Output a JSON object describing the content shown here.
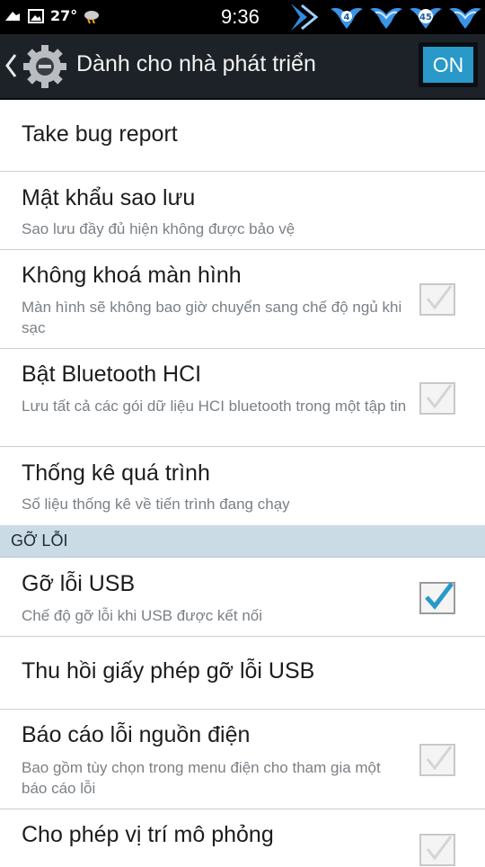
{
  "status_bar": {
    "temperature": "27°",
    "time": "9:36",
    "badge_left": "4",
    "badge_right": "45"
  },
  "action_bar": {
    "title": "Dành cho nhà phát triển",
    "toggle_label": "ON",
    "accent": "#2899c8"
  },
  "items": [
    {
      "title": "Take bug report",
      "subtitle": "",
      "checkbox": null
    },
    {
      "title": "Mật khẩu sao lưu",
      "subtitle": "Sao lưu đầy đủ hiện không được bảo vệ",
      "checkbox": null
    },
    {
      "title": "Không khoá màn hình",
      "subtitle": "Màn hình sẽ không bao giờ chuyển sang chế độ ngủ khi sạc",
      "checkbox": "disabled"
    },
    {
      "title": "Bật Bluetooth HCI",
      "subtitle": "Lưu tất cả các gói dữ liệu HCI bluetooth trong một tập tin",
      "checkbox": "disabled"
    },
    {
      "title": "Thống kê quá trình",
      "subtitle": "Số liệu thống kê về tiến trình đang chạy",
      "checkbox": null
    }
  ],
  "section_header": "GỠ LỖI",
  "items2": [
    {
      "title": "Gỡ lỗi USB",
      "subtitle": "Chế độ gỡ lỗi khi USB được kết nối",
      "checkbox": "checked"
    },
    {
      "title": "Thu hồi giấy phép gỡ lỗi USB",
      "subtitle": "",
      "checkbox": null
    },
    {
      "title": "Báo cáo lỗi nguồn điện",
      "subtitle": "Bao gồm tùy chọn trong menu điện cho tham gia một báo cáo lỗi",
      "checkbox": "disabled"
    },
    {
      "title": "Cho phép vị trí mô phỏng",
      "subtitle": "",
      "checkbox": "disabled"
    }
  ]
}
